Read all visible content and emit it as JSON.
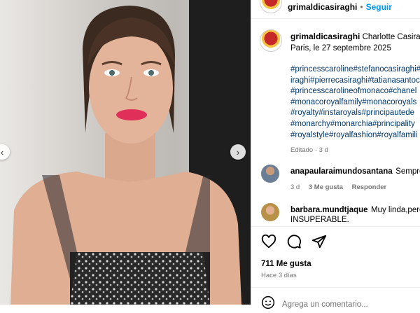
{
  "post": {
    "username": "grimaldicasiraghi",
    "separator": "•",
    "follow_label": "Seguir",
    "caption_name": "Charlotte Casiraghi",
    "caption_location": "Paris, le 27 septembre 2025",
    "hashtag_lines": [
      "#princesscaroline#stefanocasiraghi#",
      "iraghi#pierrecasiraghi#tatianasantoc",
      "#princesscarolineofmonaco#chanel",
      "#monacoroyalfamily#monacoroyals",
      "#royalty#instaroyals#principautede",
      "#monarchy#monarchia#principality",
      "#royalstyle#royalfashion#royalfamili"
    ],
    "caption_meta": "Editado · 3 d"
  },
  "comments": [
    {
      "username": "anapaularaimundosantana",
      "text": "Sempre",
      "age": "3 d",
      "likes": "3 Me gusta",
      "reply_label": "Responder"
    },
    {
      "username": "barbara.mundtjaque",
      "text": "Muy linda,perc",
      "text_line2": "INSUPERABLE."
    }
  ],
  "actions": {
    "likes_count": "711 Me gusta",
    "posted_ago": "Hace 3 días",
    "comment_placeholder": "Agrega un comentario..."
  },
  "icons": [
    "heart-icon",
    "comment-icon",
    "share-icon",
    "emoji-icon",
    "chevron-left-icon",
    "chevron-right-icon"
  ],
  "colors": {
    "link": "#0095f6",
    "hashtag": "#00376b",
    "muted": "#737373",
    "lipstick": "#e0305a"
  }
}
